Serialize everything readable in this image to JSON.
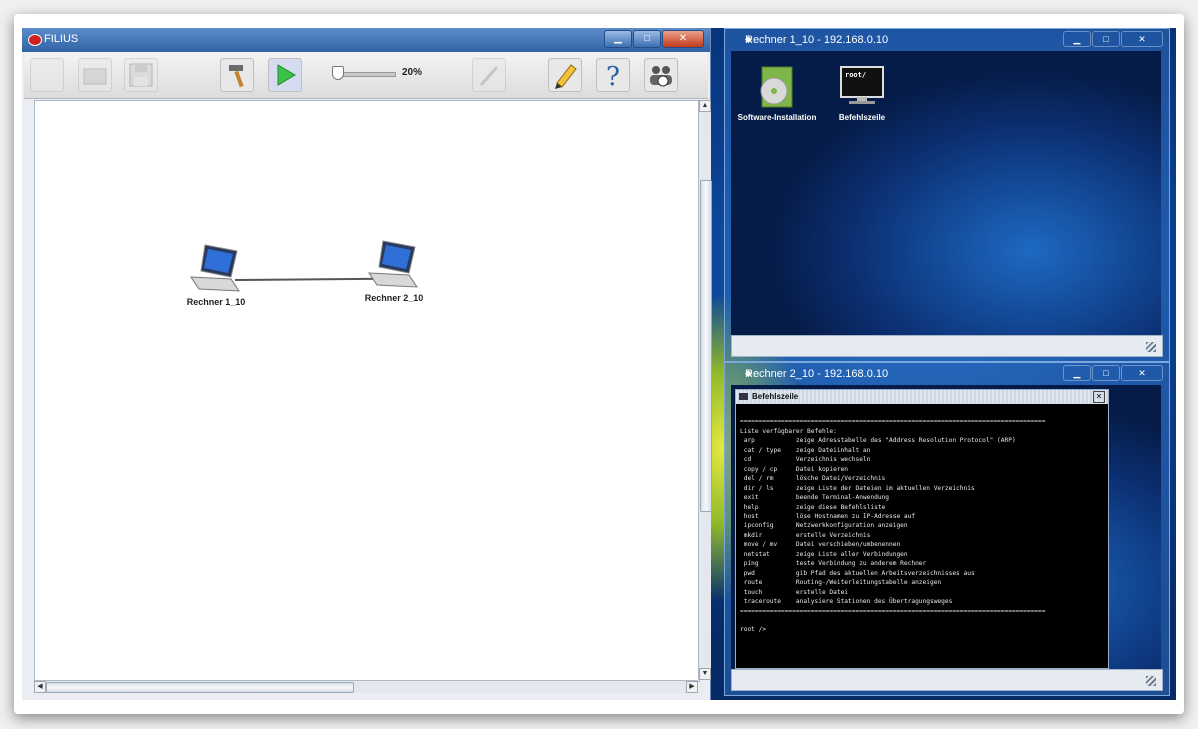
{
  "filius": {
    "title": "FILIUS",
    "zoom": "20%",
    "nodes": [
      {
        "label": "Rechner 1_10"
      },
      {
        "label": "Rechner 2_10"
      }
    ]
  },
  "window1": {
    "title": "Rechner 1_10 - 192.168.0.10",
    "icons": [
      {
        "label": "Software-Installation"
      },
      {
        "label": "Befehlszeile",
        "screen_text": "root/"
      }
    ]
  },
  "window2": {
    "title": "Rechner 2_10 - 192.168.0.10",
    "terminal_title": "Befehlszeile",
    "separator": "==================================================================================",
    "heading": "Liste verfügbarer Befehle:",
    "commands": [
      {
        "cmd": "arp",
        "desc": "zeige Adresstabelle des \"Address Resolution Protocol\" (ARP)"
      },
      {
        "cmd": "cat / type",
        "desc": "zeige Dateiinhalt an"
      },
      {
        "cmd": "cd",
        "desc": "Verzeichnis wechseln"
      },
      {
        "cmd": "copy / cp",
        "desc": "Datei kopieren"
      },
      {
        "cmd": "del / rm",
        "desc": "lösche Datei/Verzeichnis"
      },
      {
        "cmd": "dir / ls",
        "desc": "zeige Liste der Dateien im aktuellen Verzeichnis"
      },
      {
        "cmd": "exit",
        "desc": "beende Terminal-Anwendung"
      },
      {
        "cmd": "help",
        "desc": "zeige diese Befehlsliste"
      },
      {
        "cmd": "host",
        "desc": "löse Hostnamen zu IP-Adresse auf"
      },
      {
        "cmd": "ipconfig",
        "desc": "Netzwerkkonfiguration anzeigen"
      },
      {
        "cmd": "mkdir",
        "desc": "erstelle Verzeichnis"
      },
      {
        "cmd": "move / mv",
        "desc": "Datei verschieben/umbenennen"
      },
      {
        "cmd": "netstat",
        "desc": "zeige Liste aller Verbindungen"
      },
      {
        "cmd": "ping",
        "desc": "teste Verbindung zu anderem Rechner"
      },
      {
        "cmd": "pwd",
        "desc": "gib Pfad des aktuellen Arbeitsverzeichnisses aus"
      },
      {
        "cmd": "route",
        "desc": "Routing-/Weiterleitungstabelle anzeigen"
      },
      {
        "cmd": "touch",
        "desc": "erstelle Datei"
      },
      {
        "cmd": "traceroute",
        "desc": "analysiere Stationen des Übertragungsweges"
      }
    ],
    "prompt": "root />"
  },
  "colors": {
    "titlebar": "#2f63a7",
    "desktop": "#0a3f8f",
    "accent_green": "#3cc24a"
  }
}
